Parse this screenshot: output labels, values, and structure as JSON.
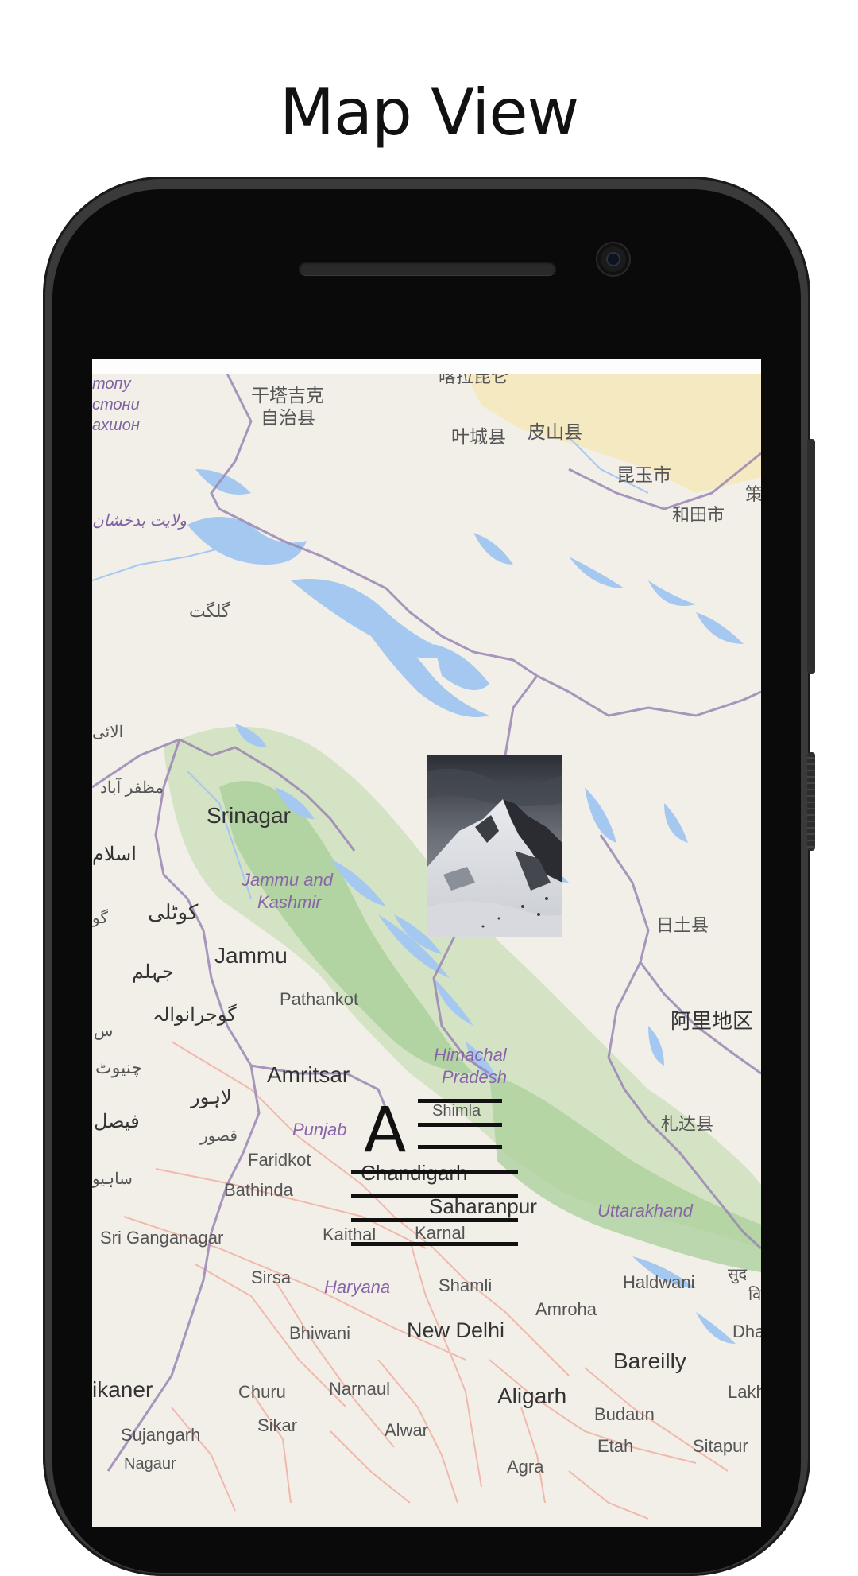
{
  "header": {
    "title": "Map View"
  },
  "map": {
    "labels": {
      "region_tajik_1": "топу",
      "region_tajik_2": "стони",
      "region_tajik_3": "ахшон",
      "taxkorgan_1": "干塔吉克",
      "taxkorgan_2": "自治县",
      "karghalik": "叶城县",
      "guma": "皮山县",
      "qaraqash": "昆玉市",
      "hotan": "和田市",
      "hotan_edge": "策",
      "badakhshan": "ولایت بدخشان",
      "gilgit": "گلگت",
      "alai": "الائی",
      "muzaffarabad": "مظفر آباد",
      "islamabad": "اسلام",
      "srinagar": "Srinagar",
      "jk_1": "Jammu and",
      "jk_2": "Kashmir",
      "kotli": "کوٹلی",
      "gujar": "گو",
      "jammu": "Jammu",
      "jhelum": "جہلم",
      "gujranwala": "گوجرانوالہ",
      "s_edge": "س",
      "pathankot": "Pathankot",
      "rutog": "日土县",
      "ngari": "阿里地区",
      "zanda": "札达县",
      "chiniot": "چنیوٹ",
      "amritsar": "Amritsar",
      "hp_1": "Himachal",
      "hp_2": "Pradesh",
      "lahore": "لاہور",
      "faisalabad": "فیصل",
      "kasur": "قصور",
      "punjab": "Punjab",
      "shimla": "Shimla",
      "sahiwal": "ساہیو",
      "faridkot": "Faridkot",
      "chandigarh": "Chandigarh",
      "bathinda": "Bathinda",
      "saharanpur": "Saharanpur",
      "uttarakhand": "Uttarakhand",
      "sri_ganganagar": "Sri Ganganagar",
      "kaithal": "Kaithal",
      "karnal": "Karnal",
      "sirsa": "Sirsa",
      "haryana": "Haryana",
      "shamli": "Shamli",
      "haldwani": "Haldwani",
      "surat_edge_1": "सुद",
      "surat_edge_2": "वि",
      "amroha": "Amroha",
      "dhang": "Dhang",
      "bhiwani": "Bhiwani",
      "new_delhi": "New Delhi",
      "bareilly": "Bareilly",
      "bikaner": "ikaner",
      "churu": "Churu",
      "narnaul": "Narnaul",
      "aligarh": "Aligarh",
      "lakh": "Lakh",
      "budaun": "Budaun",
      "sujangarh": "Sujangarh",
      "sikar": "Sikar",
      "alwar": "Alwar",
      "etah": "Etah",
      "sitapur": "Sitapur",
      "nagaur": "Nagaur",
      "agra": "Agra",
      "top_cut": "喀拉昆仑"
    },
    "markers": {
      "photo": {
        "icon": "mountain-photo"
      },
      "text": {
        "letter": "A"
      }
    }
  },
  "colors": {
    "land": "#f2efe9",
    "forest": "#add19e",
    "glacier": "#a5c8f0",
    "border": "#9a86b4",
    "road": "#f1b3a6"
  }
}
